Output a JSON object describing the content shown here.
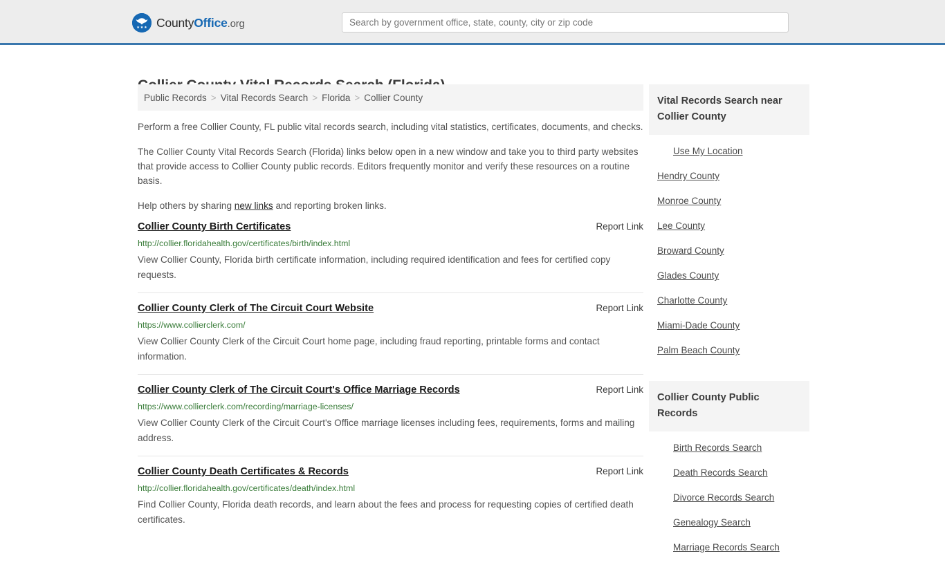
{
  "header": {
    "logo": {
      "icon": "eagle-shield-icon",
      "text_part1": "County",
      "text_part2": "Office",
      "text_part3": ".org"
    },
    "search": {
      "placeholder": "Search by government office, state, county, city or zip code",
      "value": ""
    },
    "accent_color": "#3a77ad",
    "background_color": "#ededed"
  },
  "page": {
    "title": "Collier County Vital Records Search (Florida)"
  },
  "breadcrumb": {
    "separator": ">",
    "items": [
      {
        "label": "Public Records",
        "current": false
      },
      {
        "label": "Vital Records Search",
        "current": false
      },
      {
        "label": "Florida",
        "current": false
      },
      {
        "label": "Collier County",
        "current": true
      }
    ]
  },
  "intro": {
    "p1": "Perform a free Collier County, FL public vital records search, including vital statistics, certificates, documents, and checks.",
    "p2": "The Collier County Vital Records Search (Florida) links below open in a new window and take you to third party websites that provide access to Collier County public records. Editors frequently monitor and verify these resources on a routine basis.",
    "p3_before": "Help others by sharing ",
    "p3_link": "new links",
    "p3_after": " and reporting broken links."
  },
  "results": {
    "report_label": "Report Link",
    "items": [
      {
        "title": "Collier County Birth Certificates",
        "url": "http://collier.floridahealth.gov/certificates/birth/index.html",
        "description": "View Collier County, Florida birth certificate information, including required identification and fees for certified copy requests.",
        "report": "Report Link"
      },
      {
        "title": "Collier County Clerk of The Circuit Court Website",
        "url": "https://www.collierclerk.com/",
        "description": "View Collier County Clerk of the Circuit Court home page, including fraud reporting, printable forms and contact information.",
        "report": "Report Link"
      },
      {
        "title": "Collier County Clerk of The Circuit Court's Office Marriage Records",
        "url": "https://www.collierclerk.com/recording/marriage-licenses/",
        "description": "View Collier County Clerk of the Circuit Court's Office marriage licenses including fees, requirements, forms and mailing address.",
        "report": "Report Link"
      },
      {
        "title": "Collier County Death Certificates & Records",
        "url": "http://collier.floridahealth.gov/certificates/death/index.html",
        "description": "Find Collier County, Florida death records, and learn about the fees and process for requesting copies of certified death certificates.",
        "report": "Report Link"
      }
    ]
  },
  "sidebar": {
    "nearby": {
      "heading": "Vital Records Search near Collier County",
      "links": [
        {
          "label": "Use My Location",
          "indent": true
        },
        {
          "label": "Hendry County",
          "indent": false
        },
        {
          "label": "Monroe County",
          "indent": false
        },
        {
          "label": "Lee County",
          "indent": false
        },
        {
          "label": "Broward County",
          "indent": false
        },
        {
          "label": "Glades County",
          "indent": false
        },
        {
          "label": "Charlotte County",
          "indent": false
        },
        {
          "label": "Miami-Dade County",
          "indent": false
        },
        {
          "label": "Palm Beach County",
          "indent": false
        }
      ]
    },
    "public_records": {
      "heading": "Collier County Public Records",
      "links": [
        {
          "label": "Birth Records Search",
          "indent": true
        },
        {
          "label": "Death Records Search",
          "indent": true
        },
        {
          "label": "Divorce Records Search",
          "indent": true
        },
        {
          "label": "Genealogy Search",
          "indent": true
        },
        {
          "label": "Marriage Records Search",
          "indent": true
        }
      ]
    }
  }
}
